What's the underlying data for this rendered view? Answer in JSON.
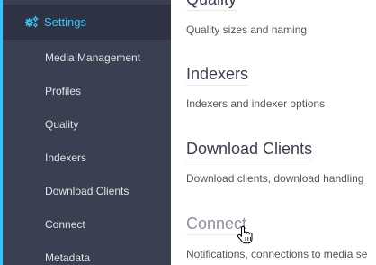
{
  "sidebar": {
    "settings_label": "Settings",
    "items": [
      {
        "label": "Media Management"
      },
      {
        "label": "Profiles"
      },
      {
        "label": "Quality"
      },
      {
        "label": "Indexers"
      },
      {
        "label": "Download Clients"
      },
      {
        "label": "Connect"
      },
      {
        "label": "Metadata"
      }
    ]
  },
  "main": {
    "sections": [
      {
        "title": "Quality",
        "description": "Quality sizes and naming"
      },
      {
        "title": "Indexers",
        "description": "Indexers and indexer options"
      },
      {
        "title": "Download Clients",
        "description": "Download clients, download handling"
      },
      {
        "title": "Connect",
        "description": "Notifications, connections to media se"
      }
    ]
  },
  "colors": {
    "sidebar_bg": "#3a3f51",
    "active_bg": "#2e3244",
    "accent": "#35c5f4",
    "title_text": "#3a3f51"
  },
  "icons": {
    "settings": "cogs-icon",
    "cursor": "hand-pointer-cursor"
  }
}
